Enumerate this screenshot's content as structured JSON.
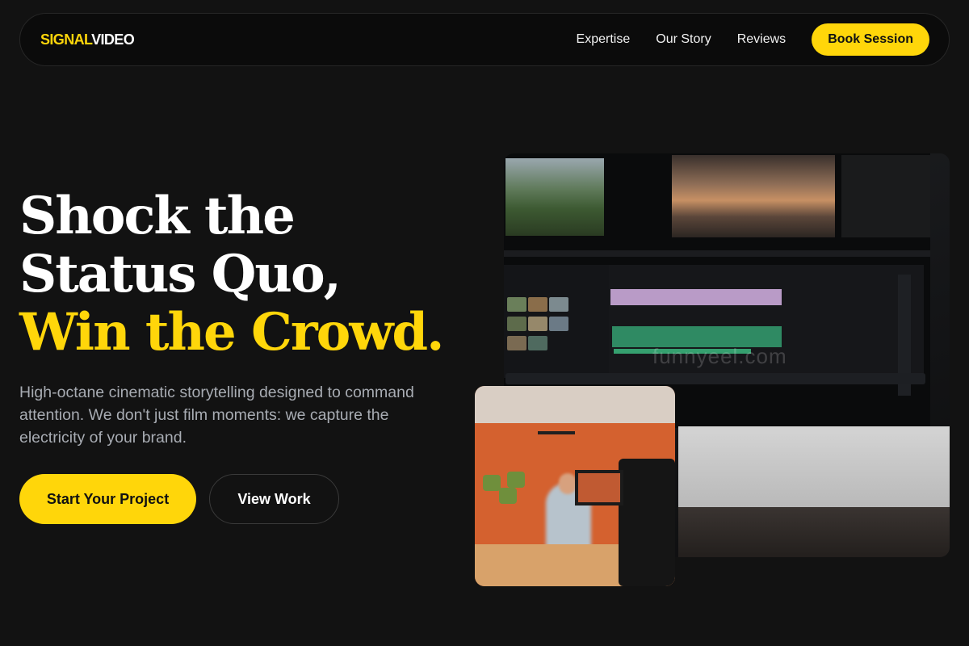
{
  "brand": {
    "logo_part1": "SIGNAL",
    "logo_part2": "VIDEO",
    "accent_color": "#FFD60A"
  },
  "nav": {
    "links": [
      "Expertise",
      "Our Story",
      "Reviews"
    ],
    "cta_label": "Book Session"
  },
  "hero": {
    "headline_line1": "Shock the",
    "headline_line2": "Status Quo,",
    "headline_line3": "Win the Crowd.",
    "subtitle": "High-octane cinematic storytelling designed to command attention. We don't just film moments: we capture the electricity of your brand.",
    "primary_cta": "Start Your Project",
    "secondary_cta": "View Work"
  },
  "media": {
    "watermark": "funnyeel.com"
  }
}
